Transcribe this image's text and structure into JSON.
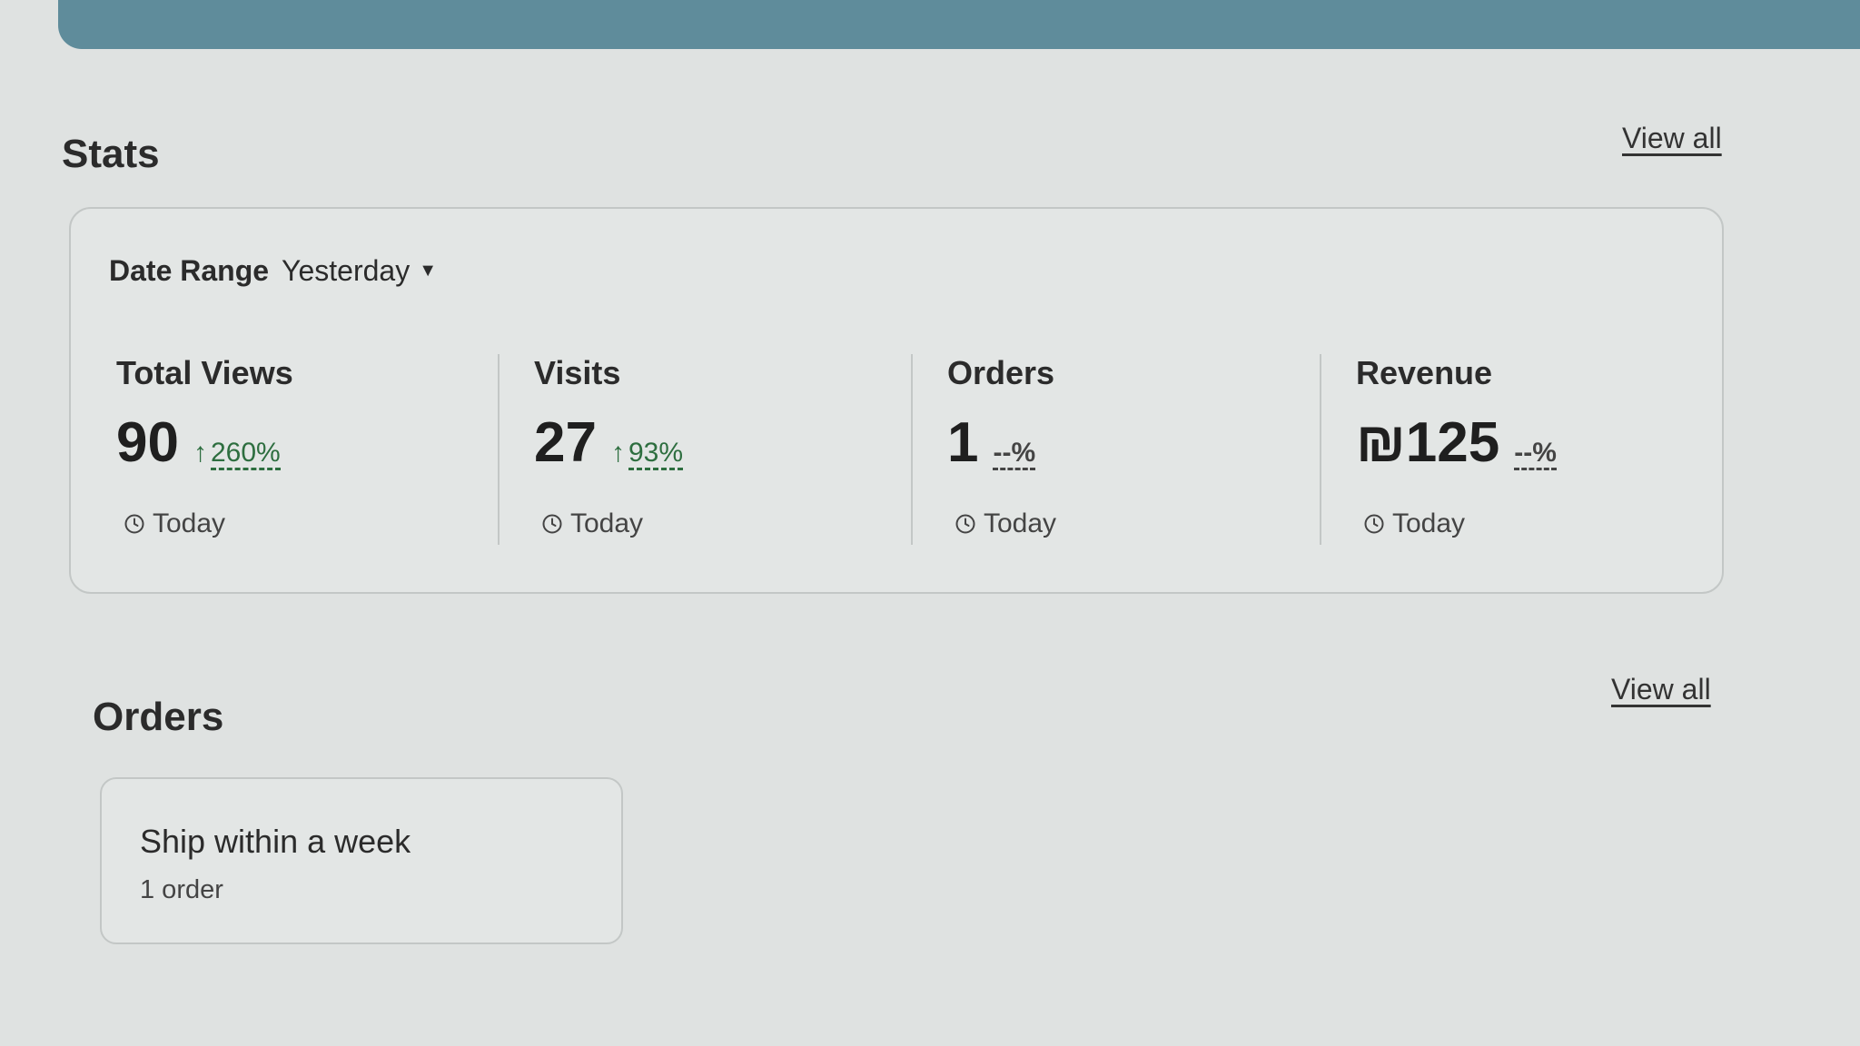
{
  "stats": {
    "title": "Stats",
    "view_all": "View all",
    "date_range": {
      "label": "Date Range",
      "value": "Yesterday"
    },
    "metrics": [
      {
        "title": "Total Views",
        "value": "90",
        "change_arrow": "↑",
        "change": "260%",
        "footer": "Today"
      },
      {
        "title": "Visits",
        "value": "27",
        "change_arrow": "↑",
        "change": "93%",
        "footer": "Today"
      },
      {
        "title": "Orders",
        "value": "1",
        "change": "--%",
        "footer": "Today"
      },
      {
        "title": "Revenue",
        "value": "₪125",
        "change": "--%",
        "footer": "Today"
      }
    ]
  },
  "orders": {
    "title": "Orders",
    "view_all": "View all",
    "card": {
      "title": "Ship within a week",
      "count": "1 order"
    }
  },
  "colors": {
    "banner": "#5f8c9b",
    "positive_change": "#2d6e3f"
  }
}
